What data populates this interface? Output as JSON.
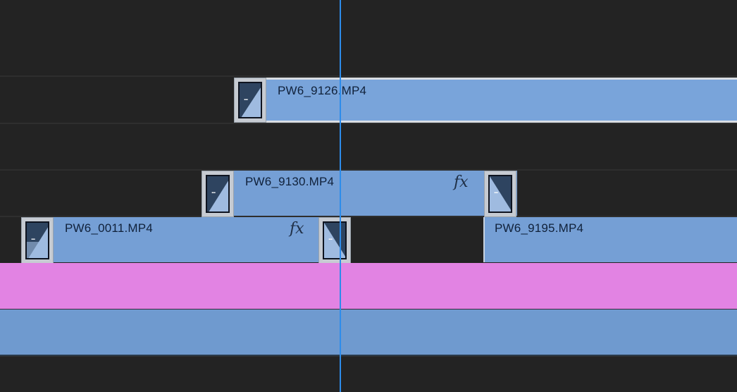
{
  "clips": {
    "v4": {
      "name": "PW6_9126.MP4"
    },
    "v3": {
      "name": "PW6_9130.MP4",
      "fx": "fx"
    },
    "v2a": {
      "name": "PW6_0011.MP4",
      "fx": "fx"
    },
    "v2b": {
      "name": "PW6_9195.MP4"
    }
  },
  "transitions": {
    "icon": "cross-dissolve-icon",
    "dots": "..."
  },
  "colors": {
    "background": "#232323",
    "video_clip": "#759fd5",
    "selected_border": "#d9dde3",
    "audio_clip_1": "#e283e3",
    "audio_clip_2": "#6f9acf",
    "playhead": "#2d8ceb"
  }
}
